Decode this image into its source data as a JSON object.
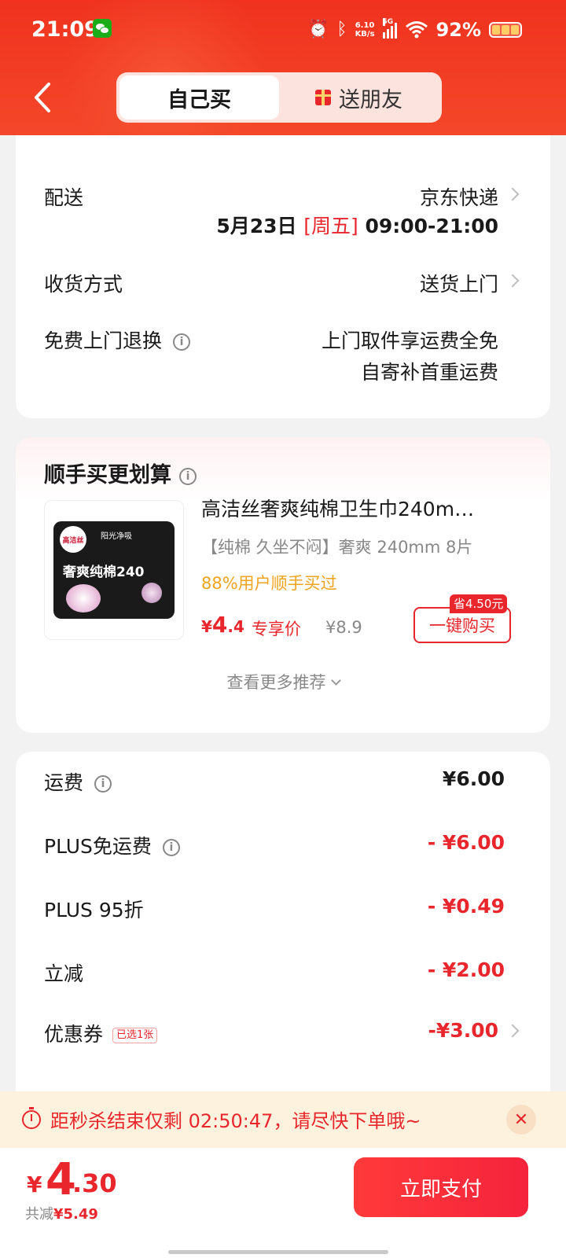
{
  "status_bar": {
    "time": "21:09",
    "net_speed_value": "6.10",
    "net_speed_unit": "KB/s",
    "signal_label": "5G",
    "battery": "92%"
  },
  "tabs": {
    "self_buy": "自己买",
    "gift_friend": "送朋友"
  },
  "delivery": {
    "label": "配送",
    "carrier": "京东快递",
    "date": "5月23日",
    "weekday": "[周五]",
    "time_range": "09:00-21:00",
    "receive_label": "收货方式",
    "receive_value": "送货上门",
    "return_label": "免费上门退换",
    "return_line1": "上门取件享运费全免",
    "return_line2": "自寄补首重运费"
  },
  "recommend": {
    "title": "顺手买更划算",
    "product_name": "高洁丝奢爽纯棉卫生巾240m…",
    "product_desc": "【纯棉 久坐不闷】奢爽 240mm 8片",
    "stat": "88%用户顺手买过",
    "price_yen": "¥",
    "price_int": "4",
    "price_dec": ".4",
    "price_tag": "专享价",
    "original_price": "¥8.9",
    "save_badge": "省4.50元",
    "buy_button": "一键购买",
    "more": "查看更多推荐",
    "pack": {
      "brand": "高洁丝",
      "series": "阳光净吸",
      "name": "奢爽纯棉240"
    }
  },
  "costs": {
    "freight_label": "运费",
    "freight_value": "¥6.00",
    "plus_free_label": "PLUS免运费",
    "plus_free_value": "- ¥6.00",
    "plus_discount_label": "PLUS 95折",
    "plus_discount_value": "- ¥0.49",
    "instant_label": "立减",
    "instant_value": "- ¥2.00",
    "coupon_label": "优惠券",
    "coupon_badge": "已选1张",
    "coupon_value": "-¥3.00"
  },
  "countdown": {
    "prefix": "距秒杀结束仅剩",
    "time": "02:50:47",
    "suffix": "，请尽快下单哦~"
  },
  "footer": {
    "yen": "¥",
    "total_int": "4",
    "total_dec": ".30",
    "saved_label": "共减",
    "saved_value": "¥5.49",
    "pay_button": "立即支付"
  },
  "colors": {
    "accent": "#e8262c",
    "header": "#f0321e",
    "highlight": "#f0a31c"
  }
}
